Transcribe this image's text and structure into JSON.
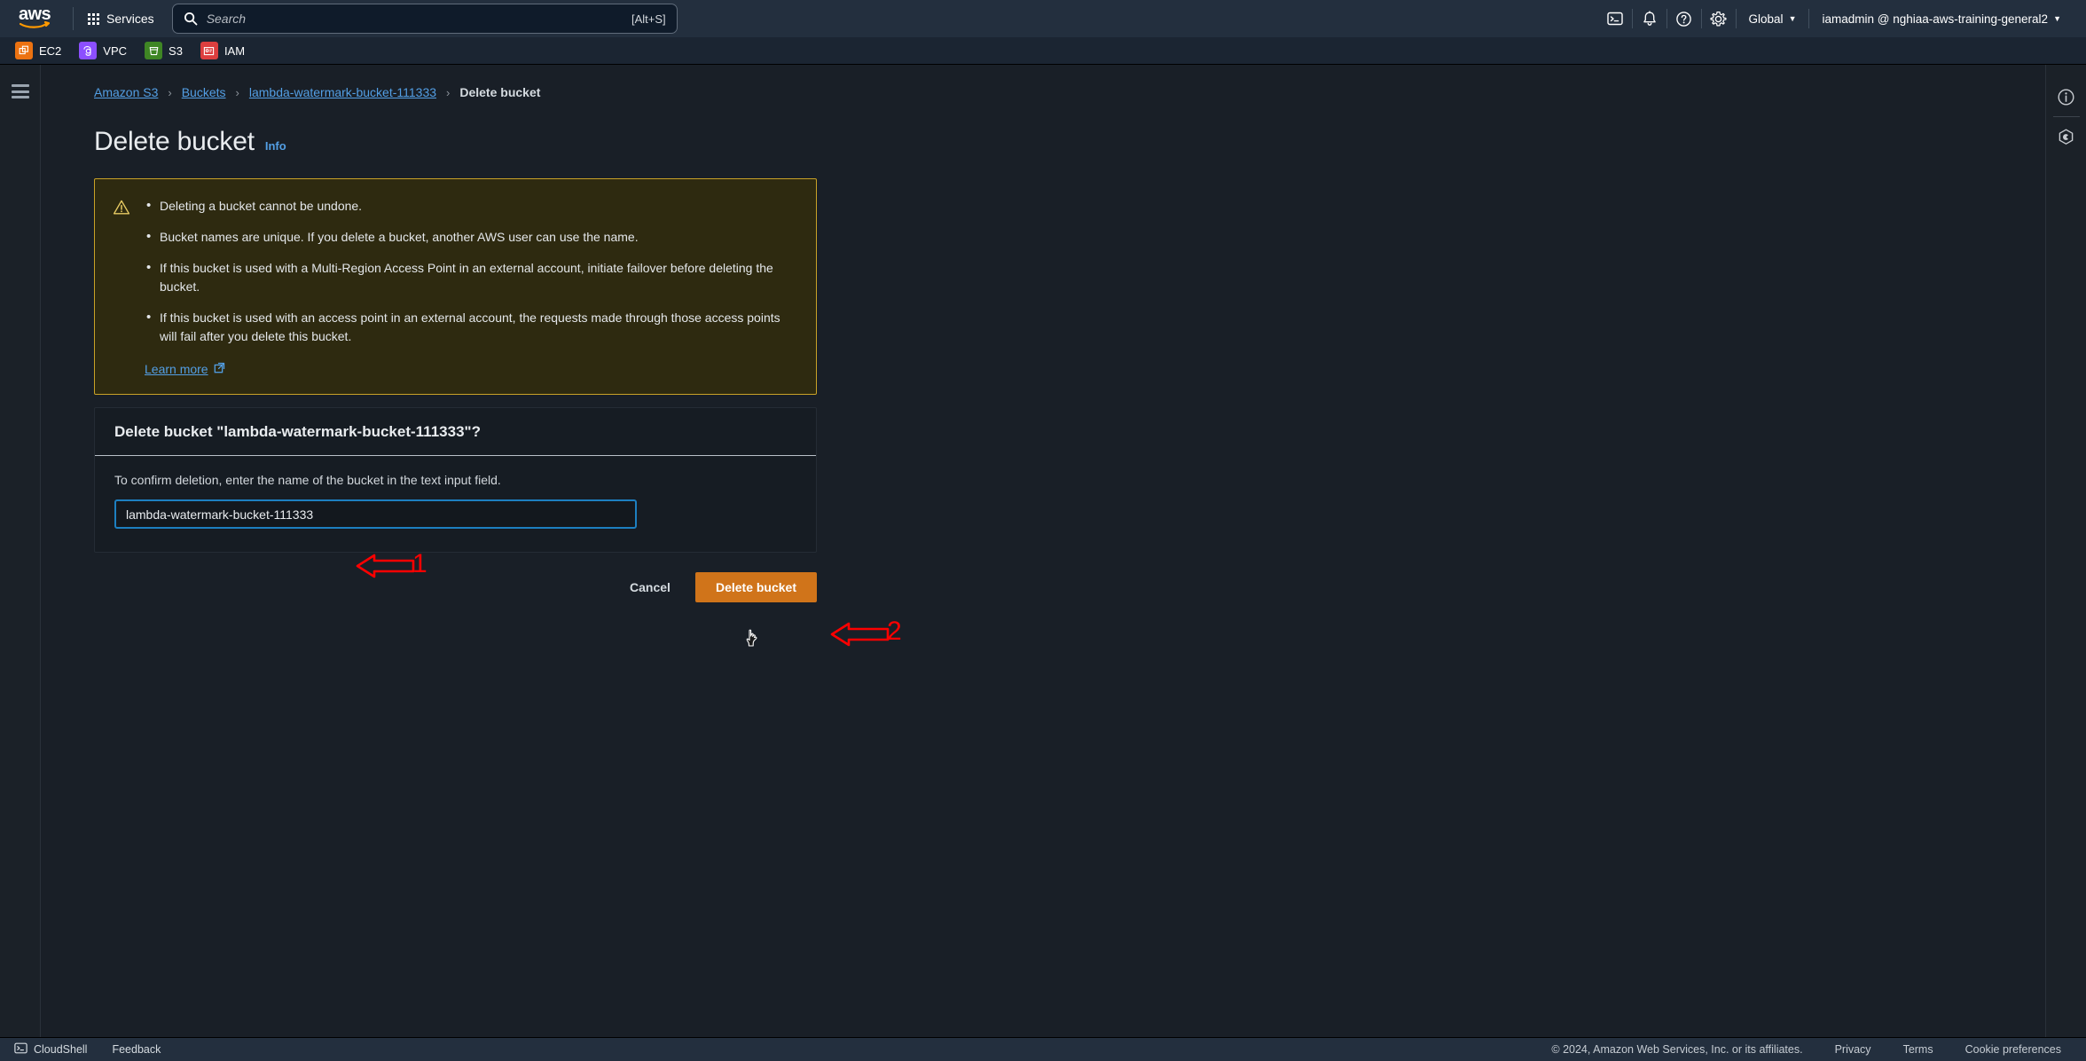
{
  "topnav": {
    "logo_alt": "aws",
    "services_label": "Services",
    "search": {
      "placeholder": "Search",
      "shortcut": "[Alt+S]"
    },
    "cloudshell_icon": "terminal-icon",
    "notifications_icon": "bell-icon",
    "help_icon": "question-circle-icon",
    "settings_icon": "gear-icon",
    "region_label": "Global",
    "account_label": "iamadmin @ nghiaa-aws-training-general2"
  },
  "shortcuts": [
    {
      "label": "EC2",
      "color": "#ec7211",
      "icon": "ec2-icon"
    },
    {
      "label": "VPC",
      "color": "#8c4fff",
      "icon": "vpc-icon"
    },
    {
      "label": "S3",
      "color": "#3f8624",
      "icon": "s3-bucket-icon"
    },
    {
      "label": "IAM",
      "color": "#dd3f3f",
      "icon": "iam-icon"
    }
  ],
  "rails": {
    "menu_icon": "hamburger-menu-icon",
    "info_icon": "info-circle-icon",
    "shield_icon": "hexagon-shield-icon"
  },
  "breadcrumb": {
    "items": [
      {
        "label": "Amazon S3",
        "link": true
      },
      {
        "label": "Buckets",
        "link": true
      },
      {
        "label": "lambda-watermark-bucket-111333",
        "link": true
      },
      {
        "label": "Delete bucket",
        "link": false
      }
    ],
    "separator": "›"
  },
  "page": {
    "title": "Delete bucket",
    "info_label": "Info"
  },
  "alert": {
    "icon": "warning-triangle-icon",
    "border_color": "#c9a227",
    "background_color": "#2e2a10",
    "bullets": [
      "Deleting a bucket cannot be undone.",
      "Bucket names are unique. If you delete a bucket, another AWS user can use the name.",
      "If this bucket is used with a Multi-Region Access Point in an external account, initiate failover before deleting the bucket.",
      "If this bucket is used with an access point in an external account, the requests made through those access points will fail after you delete this bucket."
    ],
    "learn_more_label": "Learn more",
    "learn_more_icon": "external-link-icon"
  },
  "confirm_card": {
    "heading": "Delete bucket \"lambda-watermark-bucket-111333\"?",
    "helper_text": "To confirm deletion, enter the name of the bucket in the text input field.",
    "input_value": "lambda-watermark-bucket-111333",
    "input_placeholder": ""
  },
  "actions": {
    "cancel_label": "Cancel",
    "delete_label": "Delete bucket",
    "delete_color": "#d0741a"
  },
  "annotations": [
    {
      "number": "1",
      "target": "bucket-name-input",
      "color": "#ff0000"
    },
    {
      "number": "2",
      "target": "delete-bucket-button",
      "color": "#ff0000"
    }
  ],
  "footer": {
    "cloudshell_label": "CloudShell",
    "cloudshell_icon": "terminal-icon",
    "feedback_label": "Feedback",
    "copyright": "© 2024, Amazon Web Services, Inc. or its affiliates.",
    "privacy_label": "Privacy",
    "terms_label": "Terms",
    "cookie_label": "Cookie preferences"
  }
}
